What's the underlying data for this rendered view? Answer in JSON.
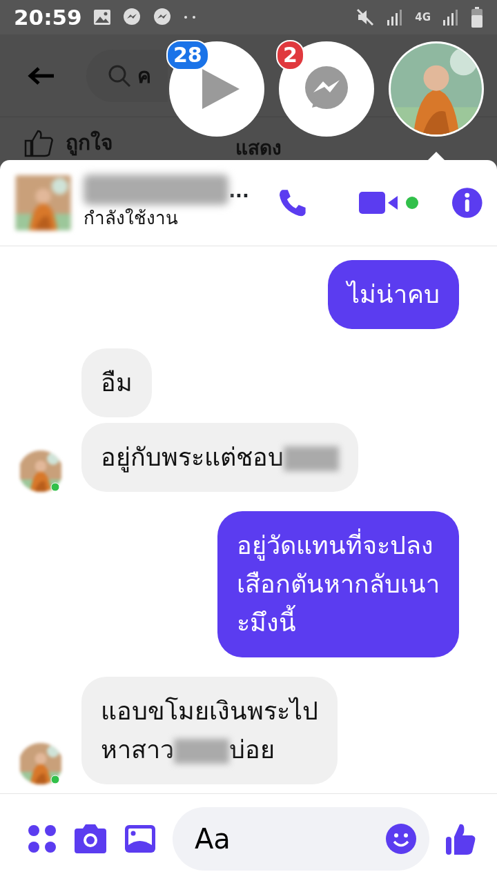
{
  "status_bar": {
    "time": "20:59",
    "network": "4G"
  },
  "background_page": {
    "search_text": "ค",
    "like_label": "ถูกใจ",
    "comment_label": "แสดง"
  },
  "chat_heads": [
    {
      "kind": "video",
      "badge": "28"
    },
    {
      "kind": "messenger",
      "badge": "2"
    },
    {
      "kind": "avatar"
    }
  ],
  "conversation": {
    "name_suffix": "...",
    "status": "กำลังใช้งาน",
    "online": true
  },
  "messages": [
    {
      "kind": "outgoing",
      "avatar": false,
      "parts": [
        {
          "kind": "text",
          "text": "ไม่น่าคบ"
        }
      ]
    },
    {
      "kind": "incoming",
      "avatar": false,
      "parts": [
        {
          "kind": "text",
          "text": "อืม"
        }
      ]
    },
    {
      "kind": "incoming",
      "avatar": true,
      "parts": [
        {
          "kind": "text",
          "text": "อยู่กับพระแต่ชอบ"
        },
        {
          "kind": "redacted"
        }
      ]
    },
    {
      "kind": "outgoing",
      "avatar": false,
      "parts": [
        {
          "kind": "text",
          "text": "อยู่วัดแทนที่จะปลง\nเสือกตันหากลับเนา\nะมึงนี้"
        }
      ]
    },
    {
      "kind": "incoming",
      "avatar": true,
      "parts": [
        {
          "kind": "text",
          "text": "แอบขโมยเงินพระไป\nหาสาว"
        },
        {
          "kind": "redacted"
        },
        {
          "kind": "text",
          "text": "บ่อย"
        }
      ]
    }
  ],
  "composer": {
    "placeholder": "Aa"
  }
}
